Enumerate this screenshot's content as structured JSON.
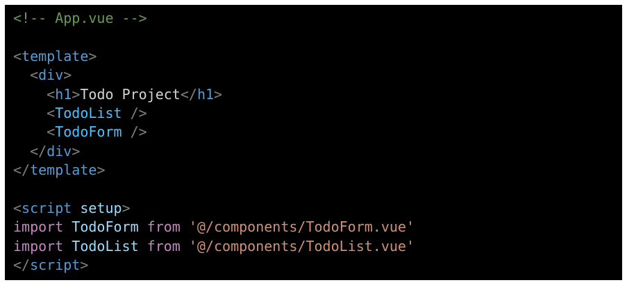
{
  "code": {
    "comment": "<!-- App.vue -->",
    "template_tag": "template",
    "div_tag": "div",
    "h1_tag": "h1",
    "h1_text": "Todo Project",
    "todolist_component": "TodoList",
    "todoform_component": "TodoForm",
    "script_tag": "script",
    "script_attr": "setup",
    "import_keyword": "import",
    "from_keyword": "from",
    "import1_name": "TodoForm",
    "import1_path": "'@/components/TodoForm.vue'",
    "import2_name": "TodoList",
    "import2_path": "'@/components/TodoList.vue'"
  }
}
